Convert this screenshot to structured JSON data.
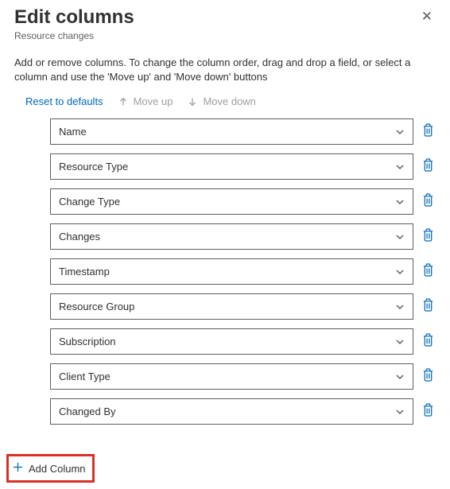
{
  "header": {
    "title": "Edit columns",
    "subtitle": "Resource changes"
  },
  "description": "Add or remove columns. To change the column order, drag and drop a field, or select a column and use the 'Move up' and 'Move down' buttons",
  "toolbar": {
    "reset": "Reset to defaults",
    "move_up": "Move up",
    "move_down": "Move down"
  },
  "columns": [
    {
      "label": "Name"
    },
    {
      "label": "Resource Type"
    },
    {
      "label": "Change Type"
    },
    {
      "label": "Changes"
    },
    {
      "label": "Timestamp"
    },
    {
      "label": "Resource Group"
    },
    {
      "label": "Subscription"
    },
    {
      "label": "Client Type"
    },
    {
      "label": "Changed By"
    }
  ],
  "add_column_label": "Add Column"
}
